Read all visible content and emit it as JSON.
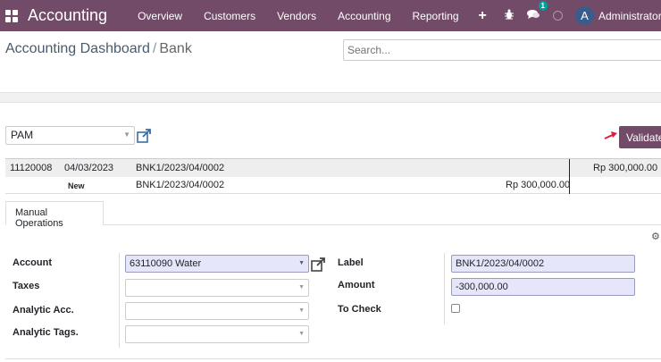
{
  "navbar": {
    "app_title": "Accounting",
    "menu": [
      "Overview",
      "Customers",
      "Vendors",
      "Accounting",
      "Reporting"
    ],
    "plus_label": "+",
    "messages_count": "1",
    "avatar_initial": "A",
    "user_name": "Administrator (c",
    "color": "#714B67"
  },
  "control_panel": {
    "breadcrumb_parent": "Accounting Dashboard",
    "breadcrumb_separator": "/",
    "breadcrumb_current": "Bank",
    "search_placeholder": "Search..."
  },
  "reconcile": {
    "partner": "PAM",
    "validate_label": "Validate",
    "line": {
      "account_code": "11120008",
      "date": "04/03/2023",
      "reference": "BNK1/2023/04/0002",
      "amount": "Rp 300,000.00"
    },
    "new_line": {
      "status": "New",
      "reference": "BNK1/2023/04/0002",
      "amount": "Rp 300,000.00"
    },
    "tab_label": "Manual Operations",
    "form": {
      "account_label": "Account",
      "account_value": "63110090 Water",
      "taxes_label": "Taxes",
      "analytic_acc_label": "Analytic Acc.",
      "analytic_tags_label": "Analytic Tags.",
      "label_label": "Label",
      "label_value": "BNK1/2023/04/0002",
      "amount_label": "Amount",
      "amount_value": "-300,000.00",
      "to_check_label": "To Check"
    }
  }
}
